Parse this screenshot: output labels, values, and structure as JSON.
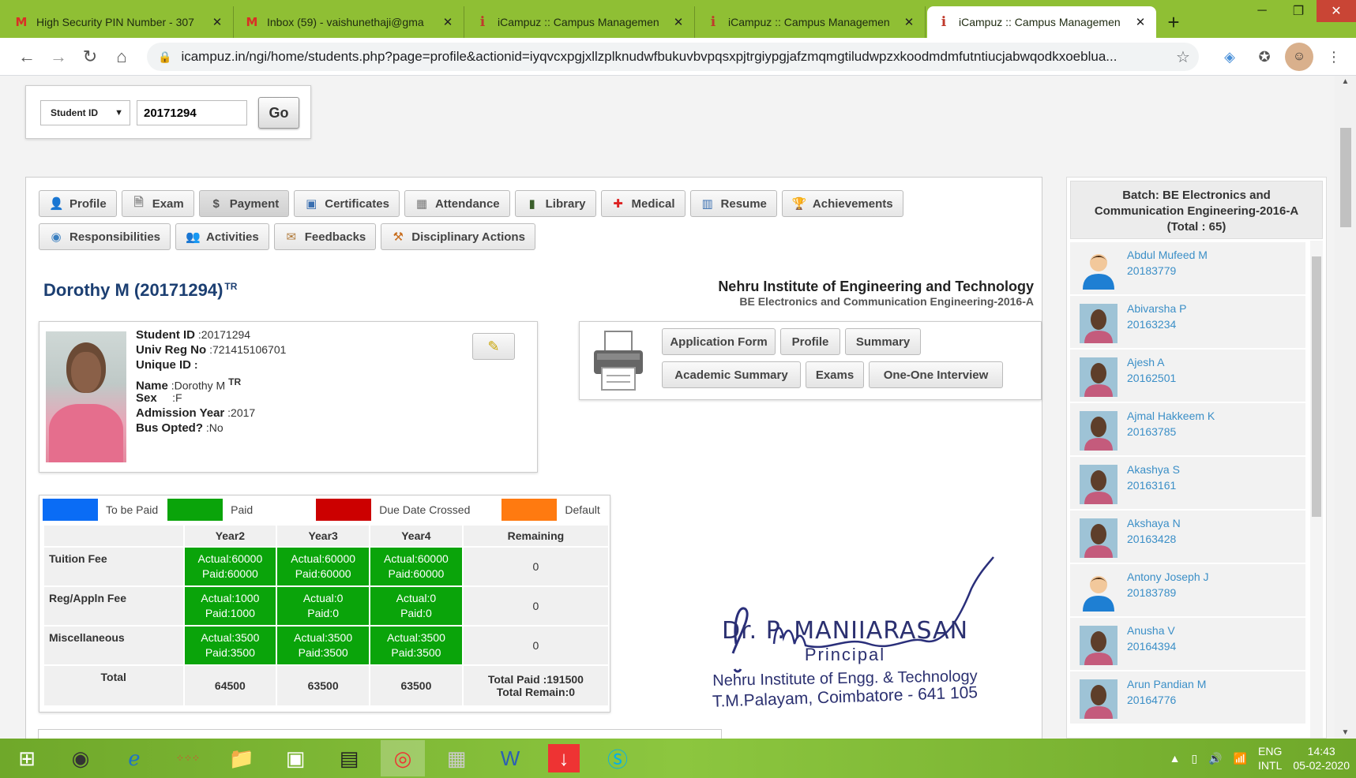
{
  "browser": {
    "tabs": [
      {
        "title": "High Security PIN Number - 307",
        "favicon": "gmail-icon"
      },
      {
        "title": "Inbox (59) - vaishunethaji@gma",
        "favicon": "gmail-icon"
      },
      {
        "title": "iCampuz :: Campus Managemen",
        "favicon": "icampuz-icon"
      },
      {
        "title": "iCampuz :: Campus Managemen",
        "favicon": "icampuz-icon"
      },
      {
        "title": "iCampuz :: Campus Managemen",
        "favicon": "icampuz-icon"
      }
    ],
    "active_tab": 4,
    "url": "icampuz.in/ngi/home/students.php?page=profile&actionid=iyqvcxpgjxllzplknudwfbukuvbvpqsxpjtrgiypgjafzmqmgtiludwpzxkoodmdmfutntiucjabwqodkxoeblua..."
  },
  "search": {
    "type_label": "Student ID",
    "value": "20171294",
    "go_label": "Go"
  },
  "nav": {
    "row1": [
      {
        "label": "Profile",
        "icon": "user-icon"
      },
      {
        "label": "Exam",
        "icon": "document-icon"
      },
      {
        "label": "Payment",
        "icon": "money-icon"
      },
      {
        "label": "Certificates",
        "icon": "certificate-icon"
      },
      {
        "label": "Attendance",
        "icon": "calendar-icon"
      },
      {
        "label": "Library",
        "icon": "book-icon"
      },
      {
        "label": "Medical",
        "icon": "medical-icon"
      },
      {
        "label": "Resume",
        "icon": "chart-icon"
      },
      {
        "label": "Achievements",
        "icon": "trophy-icon"
      }
    ],
    "row2": [
      {
        "label": "Responsibilities",
        "icon": "responsibility-icon"
      },
      {
        "label": "Activities",
        "icon": "people-icon"
      },
      {
        "label": "Feedbacks",
        "icon": "feedback-icon"
      },
      {
        "label": "Disciplinary Actions",
        "icon": "hammer-icon"
      }
    ],
    "active": "Payment"
  },
  "student": {
    "title": "Dorothy M (20171294)",
    "title_badge": "TR",
    "institute": "Nehru Institute of Engineering and Technology",
    "batch_line": "BE Electronics and Communication Engineering-2016-A",
    "fields": [
      {
        "label": "Student ID",
        "value": ":20171294"
      },
      {
        "label": "Univ Reg No",
        "value": ":721415106701"
      },
      {
        "label": "Unique ID",
        "value": ":"
      },
      {
        "label": "Name",
        "value": ":Dorothy M",
        "badge": "TR"
      },
      {
        "label": "Sex",
        "value": ":F"
      },
      {
        "label": "Admission Year",
        "value": ":2017"
      },
      {
        "label": "Bus Opted?",
        "value": ":No"
      }
    ]
  },
  "print_buttons": {
    "row1": [
      "Application Form",
      "Profile",
      "Summary"
    ],
    "row2": [
      "Academic Summary",
      "Exams",
      "One-One Interview"
    ]
  },
  "fees": {
    "legend": [
      {
        "label": "To be Paid",
        "color": "#0a6cf5"
      },
      {
        "label": "Paid",
        "color": "#0aa40a"
      },
      {
        "label": "Due Date Crossed",
        "color": "#cc0000"
      },
      {
        "label": "Default",
        "color": "#ff7a10"
      }
    ],
    "columns": [
      "Year2",
      "Year3",
      "Year4",
      "Remaining"
    ],
    "rows": [
      {
        "label": "Tuition Fee",
        "cells": [
          {
            "actual": "Actual:60000",
            "paid": "Paid:60000"
          },
          {
            "actual": "Actual:60000",
            "paid": "Paid:60000"
          },
          {
            "actual": "Actual:60000",
            "paid": "Paid:60000"
          }
        ],
        "remaining": "0"
      },
      {
        "label": "Reg/Appln Fee",
        "cells": [
          {
            "actual": "Actual:1000",
            "paid": "Paid:1000"
          },
          {
            "actual": "Actual:0",
            "paid": "Paid:0"
          },
          {
            "actual": "Actual:0",
            "paid": "Paid:0"
          }
        ],
        "remaining": "0"
      },
      {
        "label": "Miscellaneous",
        "cells": [
          {
            "actual": "Actual:3500",
            "paid": "Paid:3500"
          },
          {
            "actual": "Actual:3500",
            "paid": "Paid:3500"
          },
          {
            "actual": "Actual:3500",
            "paid": "Paid:3500"
          }
        ],
        "remaining": "0"
      }
    ],
    "total": {
      "label": "Total",
      "values": [
        "64500",
        "63500",
        "63500"
      ],
      "paid": "Total Paid :191500",
      "remain": "Total Remain:0"
    }
  },
  "signature": {
    "name": "Dr. P. MANIIARASAN",
    "designation": "Principal",
    "institution": "Nehru Institute of Engg. & Technology",
    "address": "T.M.Palayam, Coimbatore - 641 105"
  },
  "batch": {
    "header": "Batch: BE Electronics and Communication Engineering-2016-A",
    "total": "(Total : 65)",
    "students": [
      {
        "name": "Abdul Mufeed M",
        "id": "20183779",
        "avatar": "default"
      },
      {
        "name": "Abivarsha P",
        "id": "20163234",
        "avatar": "photo"
      },
      {
        "name": "Ajesh A",
        "id": "20162501",
        "avatar": "photo"
      },
      {
        "name": "Ajmal Hakkeem K",
        "id": "20163785",
        "avatar": "photo"
      },
      {
        "name": "Akashya S",
        "id": "20163161",
        "avatar": "photo"
      },
      {
        "name": "Akshaya N",
        "id": "20163428",
        "avatar": "photo"
      },
      {
        "name": "Antony Joseph J",
        "id": "20183789",
        "avatar": "default"
      },
      {
        "name": "Anusha V",
        "id": "20164394",
        "avatar": "photo"
      },
      {
        "name": "Arun Pandian M",
        "id": "20164776",
        "avatar": "photo"
      }
    ]
  },
  "taskbar": {
    "lang": "ENG",
    "layout": "INTL",
    "time": "14:43",
    "date": "05-02-2020"
  }
}
